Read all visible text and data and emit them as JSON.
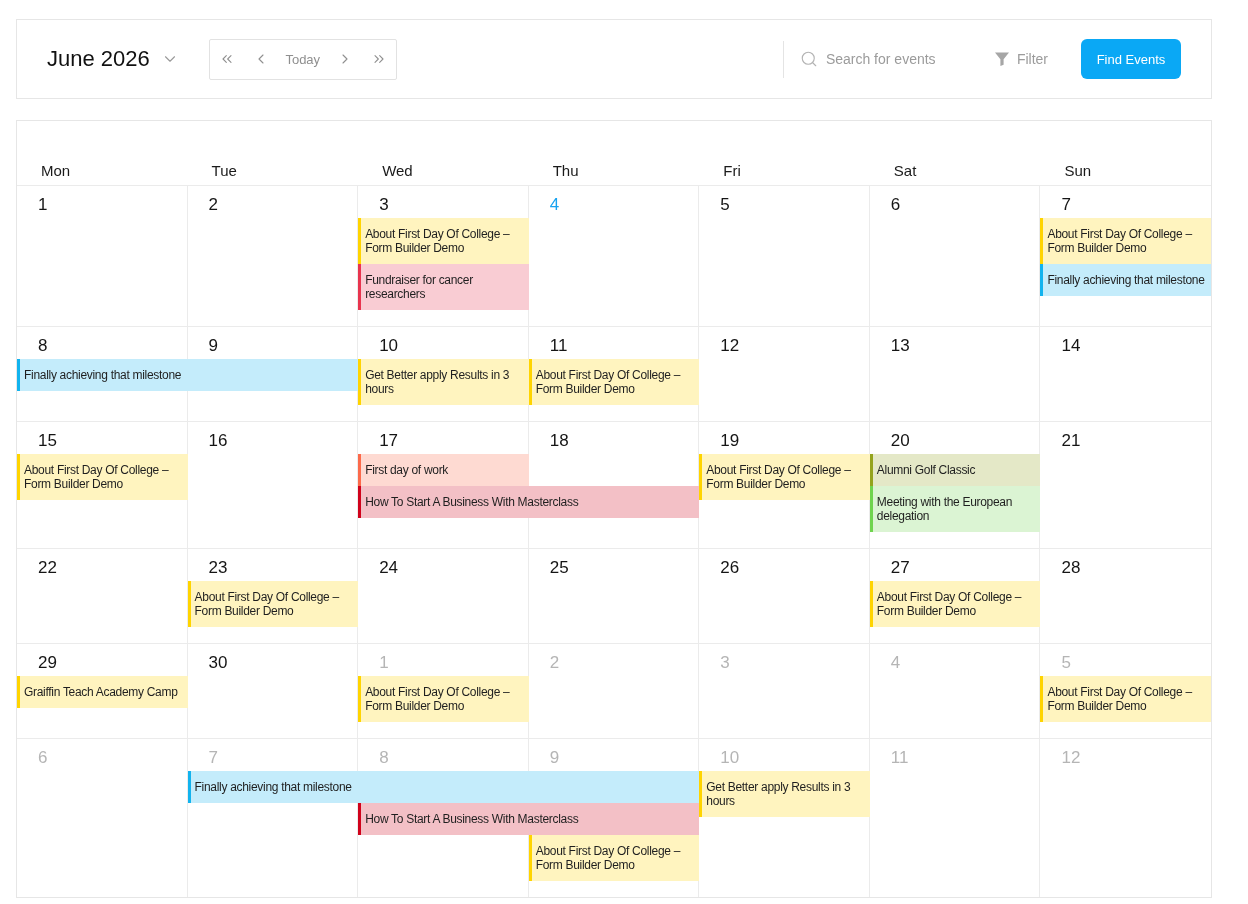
{
  "toolbar": {
    "title": "June 2026",
    "today_label": "Today",
    "search": {
      "placeholder": "Search for events"
    },
    "filter_label": "Filter",
    "find_button": "Find Events"
  },
  "calendar": {
    "weekdays": [
      "Mon",
      "Tue",
      "Wed",
      "Thu",
      "Fri",
      "Sat",
      "Sun"
    ],
    "weeks": [
      {
        "days": [
          {
            "number": "1",
            "in_month": true,
            "today": false
          },
          {
            "number": "2",
            "in_month": true,
            "today": false
          },
          {
            "number": "3",
            "in_month": true,
            "today": false,
            "events": [
              {
                "title": "About First Day Of College – Form Builder Demo",
                "color": "#ffd400"
              },
              {
                "title": "Fundraiser for cancer researchers",
                "color": "#e8344e"
              }
            ]
          },
          {
            "number": "4",
            "in_month": true,
            "today": true
          },
          {
            "number": "5",
            "in_month": true,
            "today": false
          },
          {
            "number": "6",
            "in_month": true,
            "today": false
          },
          {
            "number": "7",
            "in_month": true,
            "today": false,
            "events": [
              {
                "title": "About First Day Of College – Form Builder Demo",
                "color": "#ffd400"
              },
              {
                "title": "Finally achieving that milestone",
                "color": "#12b3ee"
              }
            ]
          }
        ]
      },
      {
        "days": [
          {
            "number": "8",
            "in_month": true,
            "today": false,
            "events": [
              {
                "title": "Finally achieving that milestone",
                "color": "#12b3ee",
                "continues": [
                  true
                ]
              }
            ]
          },
          {
            "number": "9",
            "in_month": true,
            "today": false
          },
          {
            "number": "10",
            "in_month": true,
            "today": false,
            "events": [
              {
                "title": "Get Better apply Results in 3 hours",
                "color": "#ffd400"
              }
            ]
          },
          {
            "number": "11",
            "in_month": true,
            "today": false,
            "events": [
              {
                "title": "About First Day Of College – Form Builder Demo",
                "color": "#ffd400"
              }
            ]
          },
          {
            "number": "12",
            "in_month": true,
            "today": false
          },
          {
            "number": "13",
            "in_month": true,
            "today": false
          },
          {
            "number": "14",
            "in_month": true,
            "today": false
          }
        ]
      },
      {
        "days": [
          {
            "number": "15",
            "in_month": true,
            "today": false,
            "events": [
              {
                "title": "About First Day Of College – Form Builder Demo",
                "color": "#ffd400"
              }
            ]
          },
          {
            "number": "16",
            "in_month": true,
            "today": false
          },
          {
            "number": "17",
            "in_month": true,
            "today": false,
            "events": [
              {
                "title": "First day of work",
                "color": "#fc6a4b"
              },
              {
                "title": "How To Start A Business With Masterclass",
                "color": "#d0021b",
                "continues": [
                  true
                ]
              }
            ]
          },
          {
            "number": "18",
            "in_month": true,
            "today": false
          },
          {
            "number": "19",
            "in_month": true,
            "today": false,
            "events": [
              {
                "title": "About First Day Of College – Form Builder Demo",
                "color": "#ffd400"
              }
            ]
          },
          {
            "number": "20",
            "in_month": true,
            "today": false,
            "events": [
              {
                "title": "Alumni Golf Classic",
                "color": "#94a31d"
              },
              {
                "title": "Meeting with the European delegation",
                "color": "#6fd44e"
              }
            ]
          },
          {
            "number": "21",
            "in_month": true,
            "today": false
          }
        ]
      },
      {
        "days": [
          {
            "number": "22",
            "in_month": true,
            "today": false
          },
          {
            "number": "23",
            "in_month": true,
            "today": false,
            "events": [
              {
                "title": "About First Day Of College – Form Builder Demo",
                "color": "#ffd400"
              }
            ]
          },
          {
            "number": "24",
            "in_month": true,
            "today": false
          },
          {
            "number": "25",
            "in_month": true,
            "today": false
          },
          {
            "number": "26",
            "in_month": true,
            "today": false
          },
          {
            "number": "27",
            "in_month": true,
            "today": false,
            "events": [
              {
                "title": "About First Day Of College – Form Builder Demo",
                "color": "#ffd400"
              }
            ]
          },
          {
            "number": "28",
            "in_month": true,
            "today": false
          }
        ]
      },
      {
        "days": [
          {
            "number": "29",
            "in_month": true,
            "today": false,
            "events": [
              {
                "title": "Graiffin Teach Academy Camp",
                "color": "#ffd400"
              }
            ]
          },
          {
            "number": "30",
            "in_month": true,
            "today": false
          },
          {
            "number": "1",
            "in_month": false,
            "today": false,
            "events": [
              {
                "title": "About First Day Of College – Form Builder Demo",
                "color": "#ffd400"
              }
            ]
          },
          {
            "number": "2",
            "in_month": false,
            "today": false
          },
          {
            "number": "3",
            "in_month": false,
            "today": false
          },
          {
            "number": "4",
            "in_month": false,
            "today": false
          },
          {
            "number": "5",
            "in_month": false,
            "today": false,
            "events": [
              {
                "title": "About First Day Of College – Form Builder Demo",
                "color": "#ffd400"
              }
            ]
          }
        ]
      },
      {
        "days": [
          {
            "number": "6",
            "in_month": false,
            "today": false
          },
          {
            "number": "7",
            "in_month": false,
            "today": false,
            "events": [
              {
                "title": "Finally achieving that milestone",
                "color": "#12b3ee",
                "continues": [
                  true,
                  true
                ]
              }
            ]
          },
          {
            "number": "8",
            "in_month": false,
            "today": false,
            "events": [
              {
                "title": "How To Start A Business With Masterclass",
                "color": "#d0021b",
                "continues": [
                  true
                ]
              }
            ]
          },
          {
            "number": "9",
            "in_month": false,
            "today": false,
            "events": [
              {
                "title": "About First Day Of College – Form Builder Demo",
                "color": "#ffd400"
              }
            ]
          },
          {
            "number": "10",
            "in_month": false,
            "today": false,
            "events": [
              {
                "title": "Get Better apply Results in 3 hours",
                "color": "#ffd400"
              }
            ]
          },
          {
            "number": "11",
            "in_month": false,
            "today": false
          },
          {
            "number": "12",
            "in_month": false,
            "today": false
          }
        ]
      }
    ]
  }
}
